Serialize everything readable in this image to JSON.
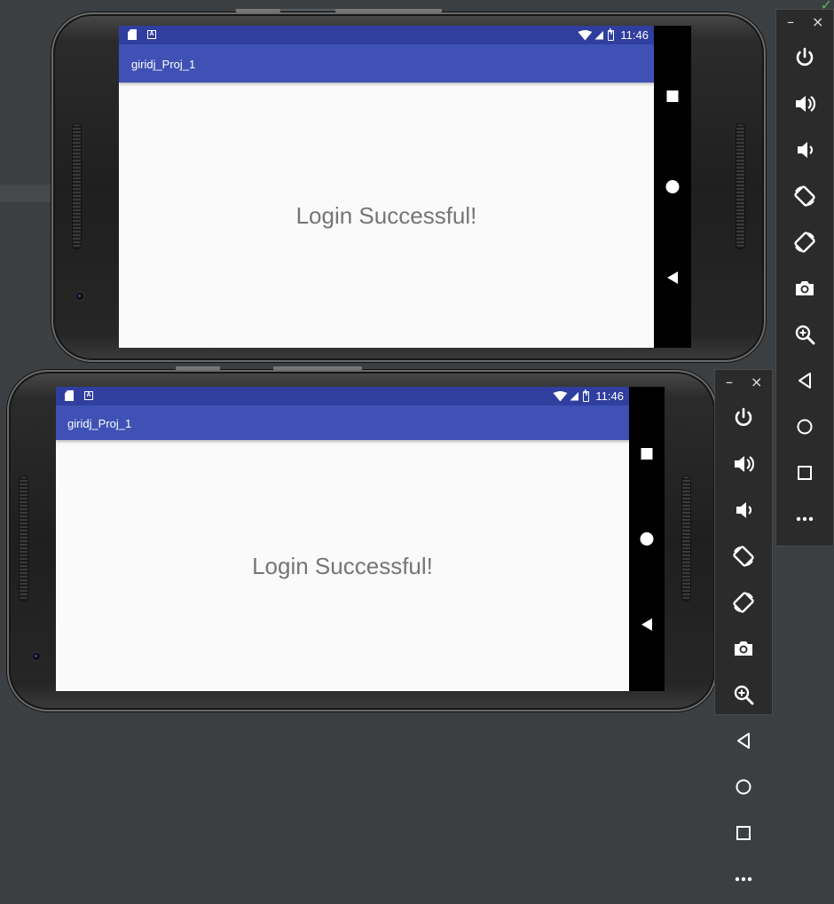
{
  "status_bar": {
    "time": "11:46"
  },
  "app": {
    "title": "giridj_Proj_1",
    "message": "Login Successful!"
  },
  "emulator_toolbar": {
    "minimize": "–",
    "close": "×",
    "buttons": [
      {
        "icon": "power-icon"
      },
      {
        "icon": "volume-up-icon"
      },
      {
        "icon": "volume-down-icon"
      },
      {
        "icon": "rotate-left-icon"
      },
      {
        "icon": "rotate-right-icon"
      },
      {
        "icon": "camera-icon"
      },
      {
        "icon": "zoom-icon"
      },
      {
        "icon": "back-icon"
      },
      {
        "icon": "home-icon"
      },
      {
        "icon": "overview-icon"
      },
      {
        "icon": "more-icon"
      }
    ]
  },
  "colors": {
    "status_bar": "#303f9f",
    "toolbar": "#3f51b5",
    "content_bg": "#fafafa",
    "ide_bg": "#3c3f41"
  }
}
